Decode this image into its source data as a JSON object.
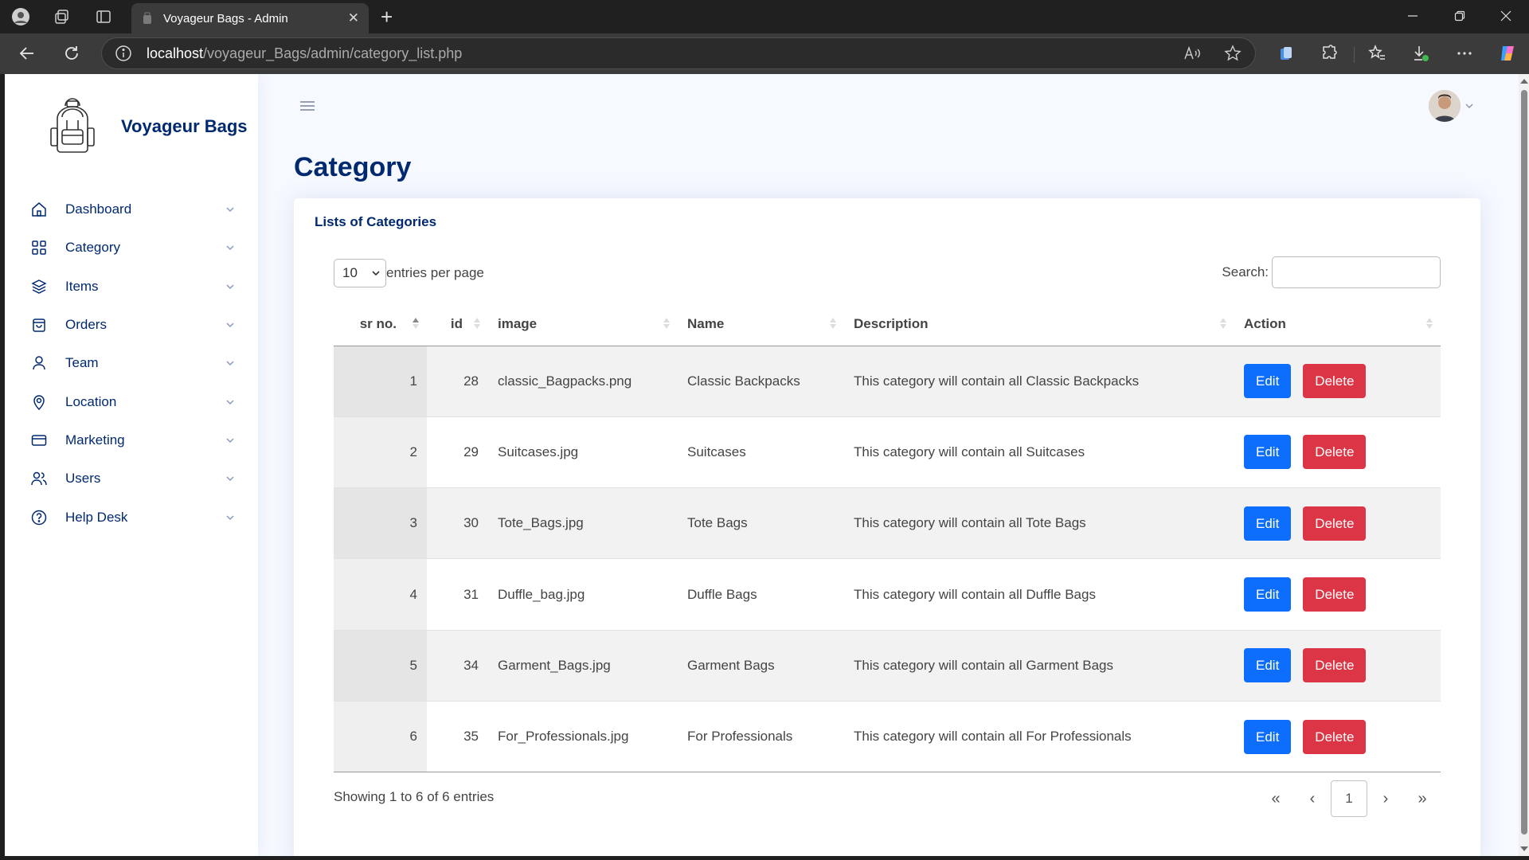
{
  "browser": {
    "tab_title": "Voyageur Bags - Admin",
    "url_host": "localhost",
    "url_path": "/voyageur_Bags/admin/category_list.php"
  },
  "sidebar": {
    "brand_name": "Voyageur Bags",
    "items": [
      {
        "label": "Dashboard",
        "icon": "house-icon"
      },
      {
        "label": "Category",
        "icon": "grid-icon"
      },
      {
        "label": "Items",
        "icon": "layers-icon"
      },
      {
        "label": "Orders",
        "icon": "bag-icon"
      },
      {
        "label": "Team",
        "icon": "person-icon"
      },
      {
        "label": "Location",
        "icon": "pin-icon"
      },
      {
        "label": "Marketing",
        "icon": "card-icon"
      },
      {
        "label": "Users",
        "icon": "people-icon"
      },
      {
        "label": "Help Desk",
        "icon": "help-icon"
      }
    ]
  },
  "main": {
    "page_title": "Category",
    "card_title": "Lists of Categories",
    "entries_value": "10",
    "entries_label": "entries per page",
    "search_label": "Search:",
    "columns": [
      "sr no.",
      "id",
      "image",
      "Name",
      "Description",
      "Action"
    ],
    "rows": [
      {
        "sr": "1",
        "id": "28",
        "image": "classic_Bagpacks.png",
        "name": "Classic Backpacks",
        "description": "This category will contain all Classic Backpacks"
      },
      {
        "sr": "2",
        "id": "29",
        "image": "Suitcases.jpg",
        "name": "Suitcases",
        "description": "This category will contain all Suitcases"
      },
      {
        "sr": "3",
        "id": "30",
        "image": "Tote_Bags.jpg",
        "name": "Tote Bags",
        "description": "This category will contain all Tote Bags"
      },
      {
        "sr": "4",
        "id": "31",
        "image": "Duffle_bag.jpg",
        "name": "Duffle Bags",
        "description": "This category will contain all Duffle Bags"
      },
      {
        "sr": "5",
        "id": "34",
        "image": "Garment_Bags.jpg",
        "name": "Garment Bags",
        "description": "This category will contain all Garment Bags"
      },
      {
        "sr": "6",
        "id": "35",
        "image": "For_Professionals.jpg",
        "name": "For Professionals",
        "description": "This category will contain all For Professionals"
      }
    ],
    "edit_label": "Edit",
    "delete_label": "Delete",
    "info": "Showing 1 to 6 of 6 entries",
    "pager": {
      "first": "«",
      "prev": "‹",
      "current": "1",
      "next": "›",
      "last": "»"
    }
  },
  "colors": {
    "primary": "#0d6efd",
    "danger": "#dc3545",
    "heading": "#012970",
    "background": "#f6f9ff"
  }
}
